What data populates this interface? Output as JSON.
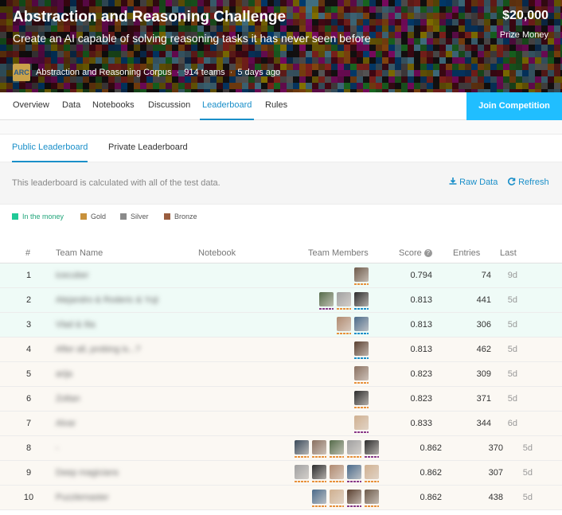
{
  "competition": {
    "title": "Abstraction and Reasoning Challenge",
    "subtitle": "Create an AI capable of solving reasoning tasks it has never seen before",
    "prize_amount": "$20,000",
    "prize_label": "Prize Money",
    "host_logo_text": "ARC",
    "host": "Abstraction and Reasoning Corpus",
    "teams": "914 teams",
    "time_ago": "5 days ago"
  },
  "nav": {
    "items": [
      {
        "label": "Overview"
      },
      {
        "label": "Data"
      },
      {
        "label": "Notebooks"
      },
      {
        "label": "Discussion"
      },
      {
        "label": "Leaderboard",
        "active": true
      },
      {
        "label": "Rules"
      }
    ],
    "join_label": "Join Competition"
  },
  "leaderboard": {
    "tabs": [
      {
        "label": "Public Leaderboard",
        "active": true
      },
      {
        "label": "Private Leaderboard"
      }
    ],
    "info_text": "This leaderboard is calculated with all of the test data.",
    "raw_data_label": "Raw Data",
    "refresh_label": "Refresh",
    "legend": [
      {
        "label": "In the money",
        "color": "#20c997"
      },
      {
        "label": "Gold",
        "color": "#c8913b"
      },
      {
        "label": "Silver",
        "color": "#8a8a8a"
      },
      {
        "label": "Bronze",
        "color": "#9a5d3f"
      }
    ],
    "columns": {
      "rank": "#",
      "team": "Team Name",
      "notebook": "Notebook",
      "members": "Team Members",
      "score": "Score",
      "entries": "Entries",
      "last": "Last"
    },
    "rows": [
      {
        "rank": "1",
        "team": "icecuber",
        "score": "0.794",
        "entries": "74",
        "last": "9d",
        "tier": "money",
        "members": 1
      },
      {
        "rank": "2",
        "team": "Alejandro & Roderic & Yuji",
        "score": "0.813",
        "entries": "441",
        "last": "5d",
        "tier": "money",
        "members": 3
      },
      {
        "rank": "3",
        "team": "Vlad & Ilia",
        "score": "0.813",
        "entries": "306",
        "last": "5d",
        "tier": "money",
        "members": 2
      },
      {
        "rank": "4",
        "team": "After all, probing is...?",
        "score": "0.813",
        "entries": "462",
        "last": "5d",
        "tier": "gold",
        "members": 1
      },
      {
        "rank": "5",
        "team": "arija",
        "score": "0.823",
        "entries": "309",
        "last": "5d",
        "tier": "gold",
        "members": 1
      },
      {
        "rank": "6",
        "team": "Zoltan",
        "score": "0.823",
        "entries": "371",
        "last": "5d",
        "tier": "gold",
        "members": 1
      },
      {
        "rank": "7",
        "team": "Alvar",
        "score": "0.833",
        "entries": "344",
        "last": "6d",
        "tier": "gold",
        "members": 1
      },
      {
        "rank": "8",
        "team": "-",
        "score": "0.862",
        "entries": "370",
        "last": "5d",
        "tier": "gold",
        "members": 5
      },
      {
        "rank": "9",
        "team": "Deep magicians",
        "score": "0.862",
        "entries": "307",
        "last": "5d",
        "tier": "gold",
        "members": 5
      },
      {
        "rank": "10",
        "team": "Puzzlemaster",
        "score": "0.862",
        "entries": "438",
        "last": "5d",
        "tier": "gold",
        "members": 4
      }
    ]
  }
}
